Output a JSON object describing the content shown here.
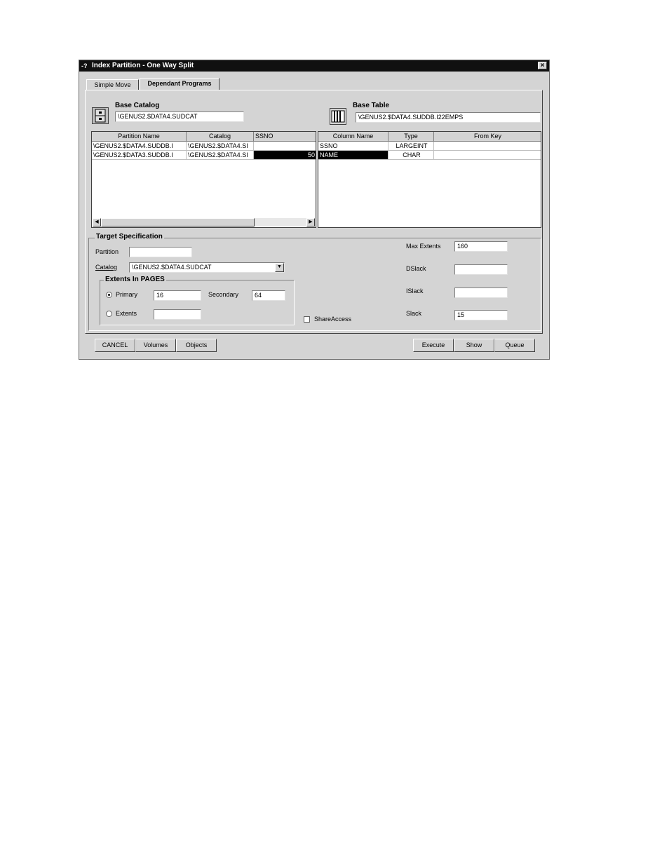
{
  "window": {
    "title": "Index Partition - One Way Split",
    "close_glyph": "×",
    "icon_glyph": "-?"
  },
  "tabs": [
    {
      "label": "Simple Move",
      "active": false
    },
    {
      "label": "Dependant Programs",
      "active": true
    }
  ],
  "base_catalog": {
    "label": "Base Catalog",
    "value": "\\GENUS2.$DATA4.SUDCAT",
    "icon": "catalog-cabinet-icon"
  },
  "base_table": {
    "label": "Base Table",
    "value": "\\GENUS2.$DATA4.SUDDB.I22EMPS",
    "icon": "table-icon"
  },
  "partition_grid": {
    "columns": [
      "Partition Name",
      "Catalog",
      "SSNO"
    ],
    "rows": [
      [
        "\\GENUS2.$DATA4.SUDDB.I",
        "\\GENUS2.$DATA4.SI",
        ""
      ],
      [
        "\\GENUS2.$DATA3.SUDDB.I",
        "\\GENUS2.$DATA4.SI",
        "50"
      ]
    ]
  },
  "column_grid": {
    "columns": [
      "Column Name",
      "Type",
      "From Key"
    ],
    "rows": [
      [
        "SSNO",
        "LARGEINT",
        ""
      ],
      [
        "NAME",
        "CHAR",
        ""
      ]
    ]
  },
  "target": {
    "title": "Target Specification",
    "partition_label": "Partition",
    "partition_value": "",
    "catalog_label": "Catalog",
    "catalog_value": "\\GENUS2.$DATA4.SUDCAT",
    "extents_title": "Extents In PAGES",
    "primary_label": "Primary",
    "primary_value": "16",
    "secondary_label": "Secondary",
    "secondary_value": "64",
    "extents_label": "Extents",
    "extents_value": "",
    "share_access_label": "ShareAccess",
    "max_extents_label": "Max Extents",
    "max_extents_value": "160",
    "dslack_label": "DSlack",
    "dslack_value": "",
    "islack_label": "ISlack",
    "islack_value": "",
    "slack_label": "Slack",
    "slack_value": "15"
  },
  "buttons": {
    "cancel": "CANCEL",
    "volumes": "Volumes",
    "objects": "Objects",
    "execute": "Execute",
    "show": "Show",
    "queue": "Queue"
  },
  "colors": {
    "titlebar": "#101010",
    "face": "#d4d4d4",
    "selection": "#000000"
  }
}
